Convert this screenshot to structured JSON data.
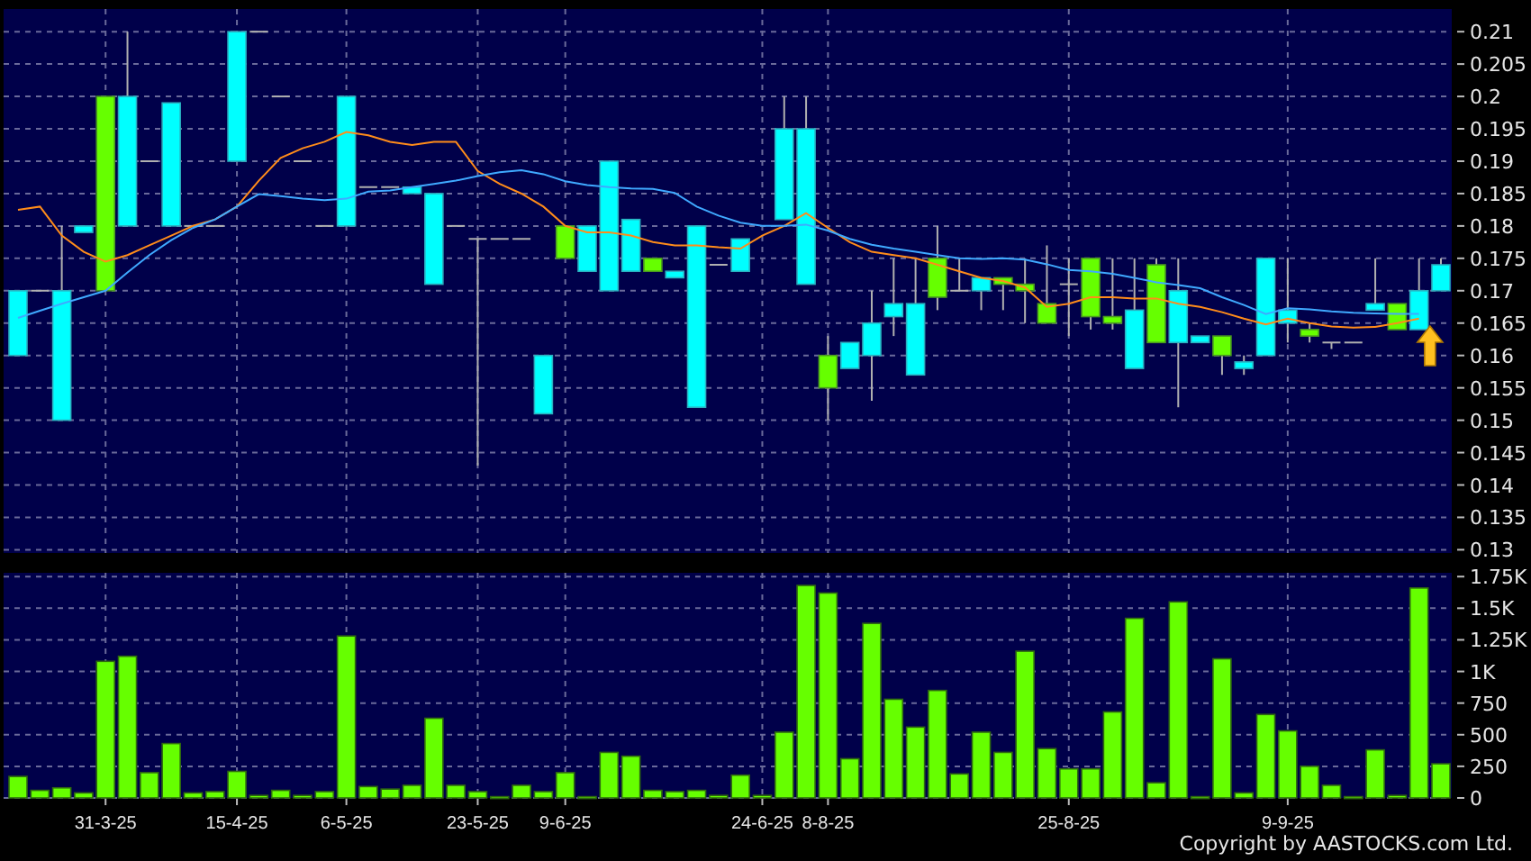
{
  "price_chart": {
    "chart_data": {
      "type": "candlestick",
      "grid": true,
      "ylim": [
        0.1295,
        0.2135
      ],
      "yticks": [
        0.13,
        0.135,
        0.14,
        0.145,
        0.15,
        0.155,
        0.16,
        0.165,
        0.17,
        0.175,
        0.18,
        0.185,
        0.19,
        0.195,
        0.2,
        0.205,
        0.21
      ],
      "categories": [
        null,
        null,
        null,
        null,
        null,
        null,
        null,
        null,
        null,
        null,
        null,
        null,
        null,
        null,
        null,
        null,
        null,
        null,
        null,
        null,
        null,
        null,
        null,
        null,
        null,
        null,
        null,
        null,
        null,
        null,
        null,
        null,
        null,
        null,
        null,
        null,
        null,
        null,
        null,
        null,
        null,
        null,
        null,
        null,
        null,
        null,
        null,
        null,
        null,
        null,
        null,
        null,
        null,
        null,
        null,
        null,
        null,
        null,
        null,
        null,
        null,
        null,
        null,
        null,
        null,
        null
      ],
      "ohlc": [
        [
          0.17,
          0.17,
          0.16,
          0.16
        ],
        [
          0.17,
          0.17,
          0.17,
          0.17
        ],
        [
          0.17,
          0.18,
          0.15,
          0.15
        ],
        [
          0.18,
          0.18,
          0.179,
          0.179
        ],
        [
          0.17,
          0.2,
          0.17,
          0.2
        ],
        [
          0.2,
          0.21,
          0.18,
          0.18
        ],
        [
          0.19,
          0.19,
          0.19,
          0.19
        ],
        [
          0.199,
          0.199,
          0.18,
          0.18
        ],
        [
          0.18,
          0.18,
          0.18,
          0.18
        ],
        [
          0.18,
          0.18,
          0.18,
          0.18
        ],
        [
          0.21,
          0.21,
          0.19,
          0.19
        ],
        [
          0.21,
          0.21,
          0.21,
          0.21
        ],
        [
          0.2,
          0.2,
          0.2,
          0.2
        ],
        [
          0.19,
          0.19,
          0.19,
          0.19
        ],
        [
          0.18,
          0.18,
          0.18,
          0.18
        ],
        [
          0.2,
          0.2,
          0.18,
          0.18
        ],
        [
          0.186,
          0.186,
          0.186,
          0.186
        ],
        [
          0.186,
          0.186,
          0.186,
          0.186
        ],
        [
          0.186,
          0.186,
          0.185,
          0.185
        ],
        [
          0.185,
          0.185,
          0.171,
          0.171
        ],
        [
          0.18,
          0.18,
          0.18,
          0.18
        ],
        [
          0.178,
          0.178,
          0.143,
          0.178
        ],
        [
          0.178,
          0.178,
          0.178,
          0.178
        ],
        [
          0.178,
          0.178,
          0.178,
          0.178
        ],
        [
          0.16,
          0.16,
          0.151,
          0.151
        ],
        [
          0.175,
          0.18,
          0.175,
          0.18
        ],
        [
          0.18,
          0.18,
          0.173,
          0.173
        ],
        [
          0.19,
          0.19,
          0.17,
          0.17
        ],
        [
          0.181,
          0.181,
          0.173,
          0.173
        ],
        [
          0.173,
          0.175,
          0.173,
          0.175
        ],
        [
          0.173,
          0.173,
          0.172,
          0.172
        ],
        [
          0.18,
          0.18,
          0.152,
          0.152
        ],
        [
          0.174,
          0.174,
          0.174,
          0.174
        ],
        [
          0.178,
          0.178,
          0.173,
          0.173
        ],
        null,
        [
          0.195,
          0.2,
          0.181,
          0.181
        ],
        [
          0.195,
          0.2,
          0.171,
          0.171
        ],
        [
          0.155,
          0.163,
          0.15,
          0.16
        ],
        [
          0.162,
          0.162,
          0.158,
          0.158
        ],
        [
          0.165,
          0.17,
          0.153,
          0.16
        ],
        [
          0.168,
          0.175,
          0.163,
          0.166
        ],
        [
          0.168,
          0.175,
          0.157,
          0.157
        ],
        [
          0.169,
          0.18,
          0.167,
          0.175
        ],
        [
          0.17,
          0.175,
          0.17,
          0.17
        ],
        [
          0.172,
          0.172,
          0.167,
          0.17
        ],
        [
          0.171,
          0.172,
          0.167,
          0.172
        ],
        [
          0.17,
          0.175,
          0.165,
          0.171
        ],
        [
          0.165,
          0.177,
          0.165,
          0.168
        ],
        [
          0.171,
          0.175,
          0.163,
          0.171
        ],
        [
          0.166,
          0.175,
          0.164,
          0.175
        ],
        [
          0.165,
          0.175,
          0.164,
          0.166
        ],
        [
          0.167,
          0.175,
          0.158,
          0.158
        ],
        [
          0.162,
          0.175,
          0.162,
          0.174
        ],
        [
          0.17,
          0.175,
          0.152,
          0.162
        ],
        [
          0.163,
          0.163,
          0.162,
          0.162
        ],
        [
          0.16,
          0.163,
          0.157,
          0.163
        ],
        [
          0.159,
          0.16,
          0.157,
          0.158
        ],
        [
          0.175,
          0.175,
          0.16,
          0.16
        ],
        [
          0.167,
          0.175,
          0.162,
          0.165
        ],
        [
          0.163,
          0.165,
          0.162,
          0.164
        ],
        [
          0.162,
          0.162,
          0.161,
          0.162
        ],
        [
          0.162,
          0.162,
          0.162,
          0.162
        ],
        [
          0.168,
          0.175,
          0.167,
          0.167
        ],
        [
          0.164,
          0.168,
          0.164,
          0.168
        ],
        [
          0.17,
          0.175,
          0.164,
          0.164
        ],
        [
          0.174,
          0.175,
          0.17,
          0.17
        ]
      ],
      "series": [
        {
          "type": "line",
          "color": "#ff8c1a",
          "values": [
            0.1825,
            0.183,
            0.1785,
            0.176,
            0.1745,
            0.1755,
            0.177,
            0.1785,
            0.18,
            0.181,
            0.183,
            0.187,
            0.1905,
            0.192,
            0.193,
            0.1945,
            0.194,
            0.193,
            0.1925,
            0.193,
            0.193,
            0.1885,
            0.1865,
            0.185,
            0.183,
            0.18,
            0.179,
            0.179,
            0.1785,
            0.1775,
            0.177,
            0.177,
            0.1767,
            0.1765,
            0.1785,
            0.18,
            0.182,
            0.1797,
            0.1775,
            0.176,
            0.1755,
            0.175,
            0.174,
            0.173,
            0.172,
            0.1715,
            0.1705,
            0.1675,
            0.168,
            0.169,
            0.169,
            0.1688,
            0.1688,
            0.168,
            0.1675,
            0.1667,
            0.1657,
            0.1648,
            0.1657,
            0.165,
            0.1645,
            0.1643,
            0.1644,
            0.165,
            0.1657,
            null
          ]
        },
        {
          "type": "line",
          "color": "#3fa9ff",
          "values": [
            0.1658,
            0.1669,
            0.168,
            0.169,
            0.17,
            0.1728,
            0.1755,
            0.1778,
            0.1797,
            0.181,
            0.183,
            0.1849,
            0.1846,
            0.1842,
            0.184,
            0.1842,
            0.1853,
            0.1855,
            0.186,
            0.1865,
            0.187,
            0.1877,
            0.1883,
            0.1886,
            0.188,
            0.1869,
            0.1863,
            0.186,
            0.1858,
            0.1857,
            0.1851,
            0.183,
            0.1816,
            0.1805,
            0.18,
            0.18,
            0.1802,
            0.1793,
            0.178,
            0.1771,
            0.1765,
            0.176,
            0.1755,
            0.175,
            0.1749,
            0.175,
            0.1748,
            0.1741,
            0.1732,
            0.173,
            0.1726,
            0.172,
            0.1713,
            0.1709,
            0.1704,
            0.169,
            0.1678,
            0.1664,
            0.1673,
            0.1671,
            0.1668,
            0.1666,
            0.1665,
            0.1664,
            0.1664,
            null
          ]
        }
      ]
    }
  },
  "volume_chart": {
    "chart_data": {
      "type": "bar",
      "grid": true,
      "ylim": [
        0,
        1780
      ],
      "categories": [
        null,
        null,
        null,
        null,
        "31-3-25",
        null,
        null,
        null,
        null,
        null,
        "15-4-25",
        null,
        null,
        null,
        null,
        "6-5-25",
        null,
        null,
        null,
        null,
        null,
        "23-5-25",
        null,
        null,
        null,
        "9-6-25",
        null,
        null,
        null,
        null,
        null,
        null,
        null,
        null,
        "24-6-25",
        null,
        null,
        "8-8-25",
        null,
        null,
        null,
        null,
        null,
        null,
        null,
        null,
        null,
        null,
        "25-8-25",
        null,
        null,
        null,
        null,
        null,
        null,
        null,
        null,
        null,
        "9-9-25",
        null,
        null,
        null,
        null,
        null,
        null,
        null
      ],
      "yticks": [
        0,
        250,
        500,
        750,
        {
          "value": 1000,
          "label": "1K"
        },
        {
          "value": 1250,
          "label": "1.25K"
        },
        {
          "value": 1500,
          "label": "1.5K"
        },
        {
          "value": 1750,
          "label": "1.75K"
        }
      ],
      "series": [
        {
          "color": "#66ff00",
          "values": [
            170,
            60,
            80,
            40,
            1080,
            1120,
            200,
            430,
            40,
            50,
            210,
            20,
            60,
            20,
            50,
            1280,
            90,
            70,
            100,
            630,
            100,
            50,
            10,
            100,
            50,
            200,
            10,
            360,
            330,
            60,
            50,
            60,
            20,
            180,
            20,
            520,
            1680,
            1620,
            310,
            1380,
            780,
            560,
            850,
            190,
            520,
            360,
            1160,
            390,
            230,
            230,
            680,
            1420,
            120,
            1550,
            10,
            1100,
            40,
            660,
            530,
            250,
            100,
            10,
            380,
            20,
            1660,
            270
          ]
        }
      ]
    }
  },
  "copyright": "Copyright by AASTOCKS.com Ltd."
}
